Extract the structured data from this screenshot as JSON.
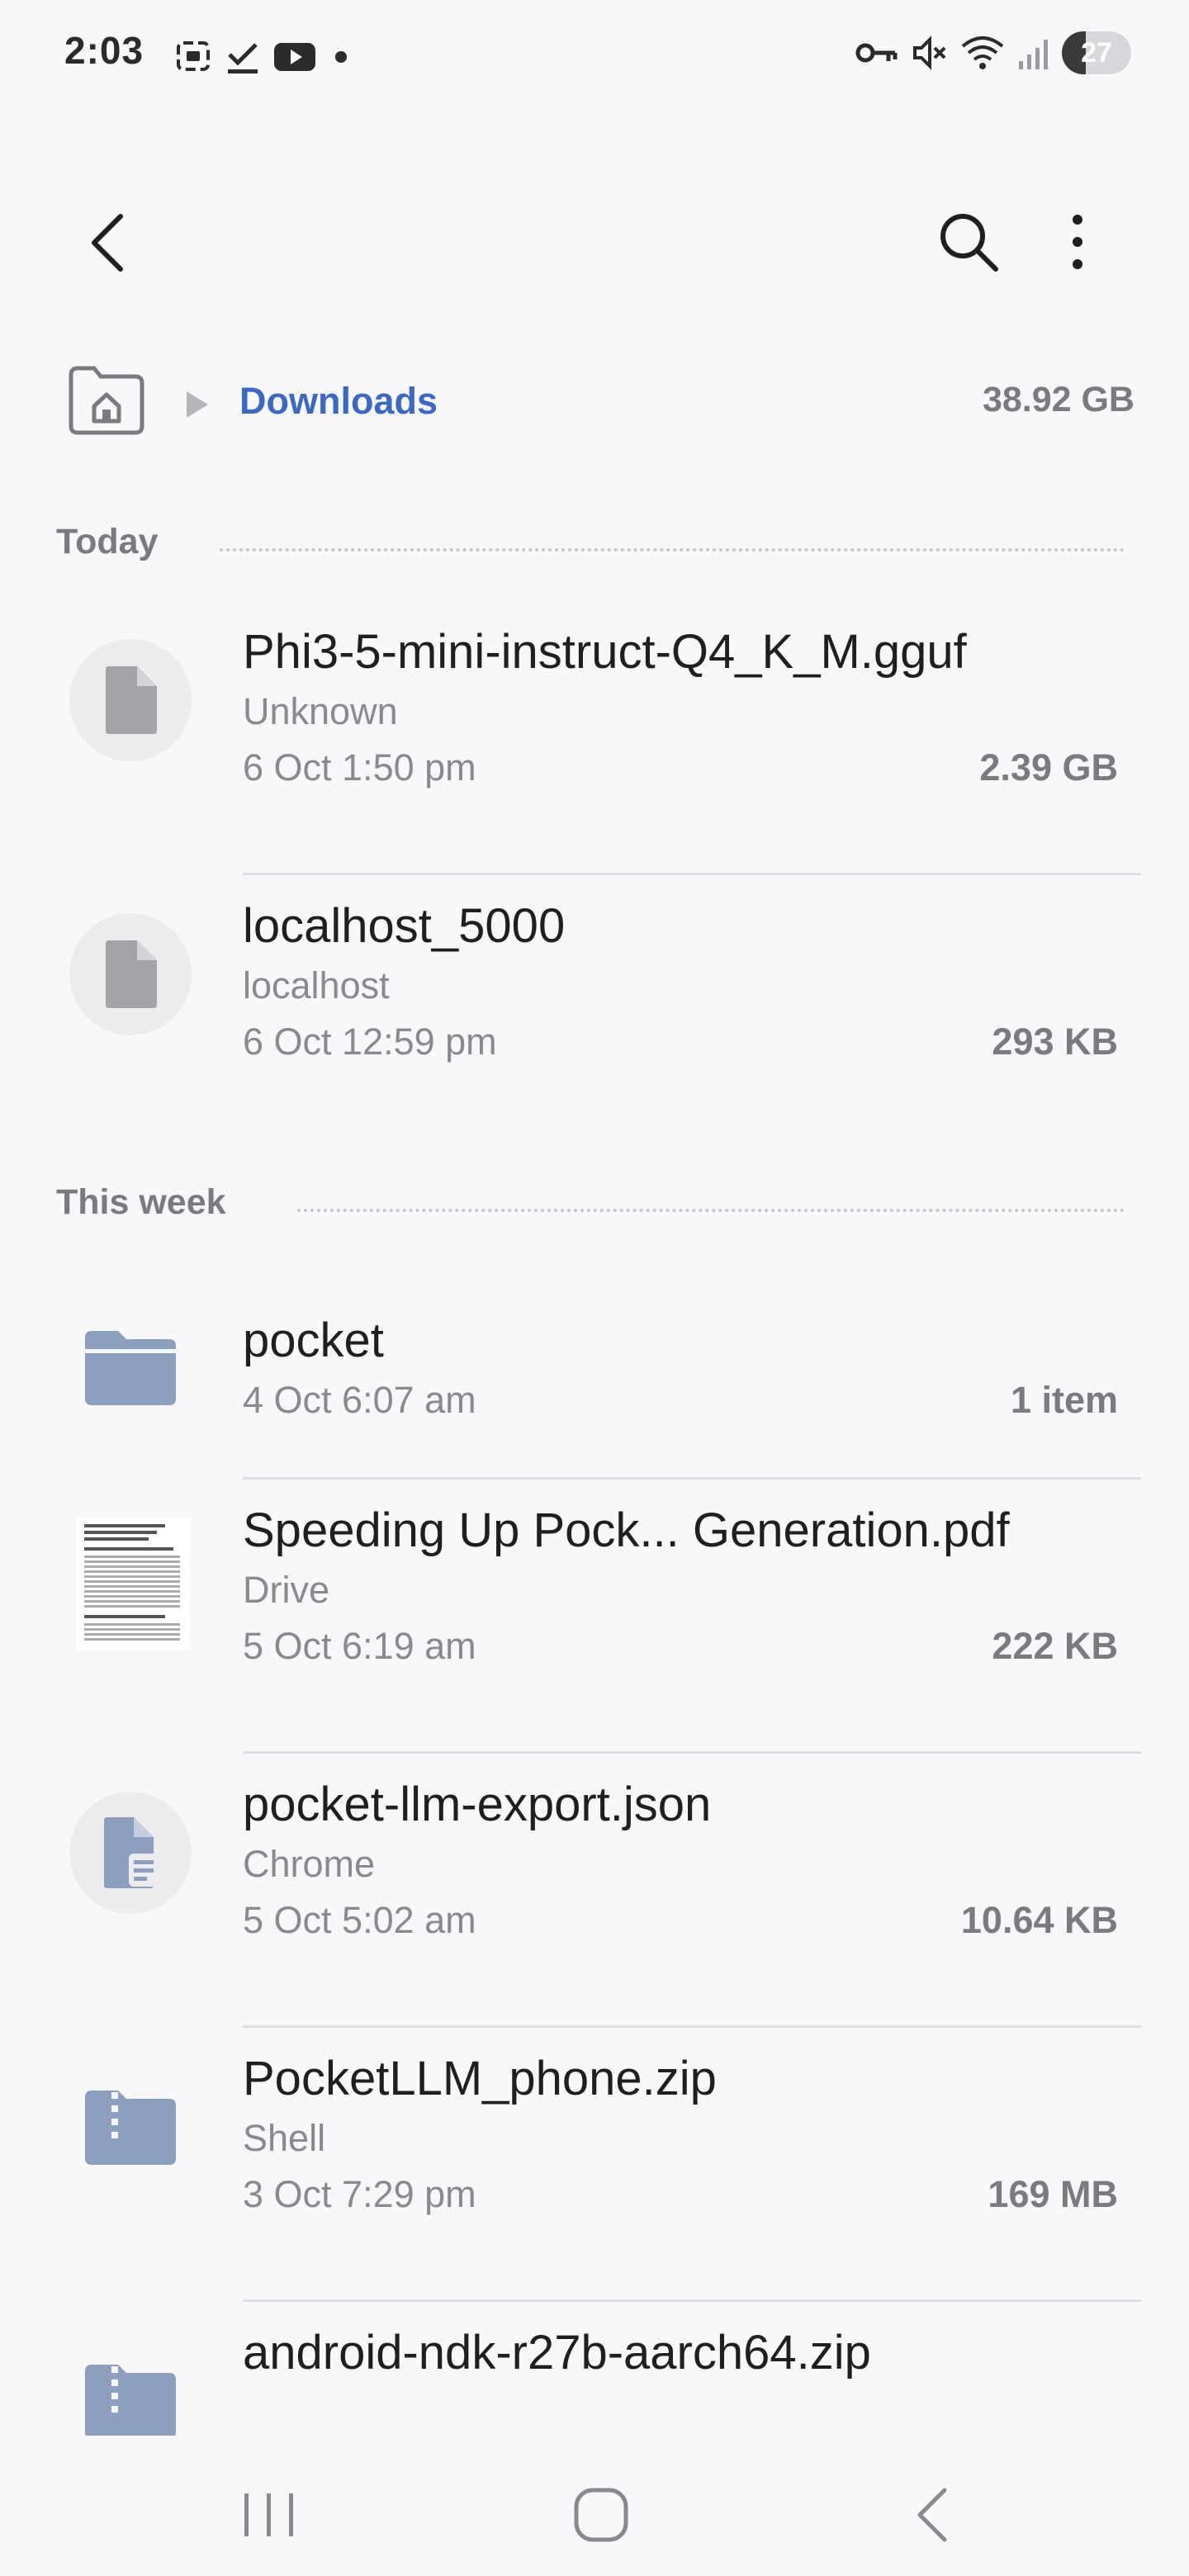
{
  "status_bar": {
    "time": "2:03",
    "battery": "27",
    "icons_left": [
      "screenshot-icon",
      "download-done-icon",
      "youtube-icon",
      "dot-icon"
    ],
    "icons_right": [
      "vpn-key-icon",
      "mute-icon",
      "wifi-icon",
      "signal-icon",
      "battery-icon"
    ]
  },
  "breadcrumb": {
    "current": "Downloads",
    "storage": "38.92 GB"
  },
  "sections": [
    {
      "label": "Today",
      "items": [
        {
          "name": "Phi3-5-mini-instruct-Q4_K_M.gguf",
          "source": "Unknown",
          "date": "6 Oct 1:50 pm",
          "size": "2.39 GB",
          "icon": "file-icon"
        },
        {
          "name": "localhost_5000",
          "source": "localhost",
          "date": "6 Oct 12:59 pm",
          "size": "293 KB",
          "icon": "file-icon"
        }
      ]
    },
    {
      "label": "This week",
      "items": [
        {
          "name": "pocket",
          "source": "",
          "date": "4 Oct 6:07 am",
          "size": "1 item",
          "icon": "folder-icon"
        },
        {
          "name": "Speeding Up Pock... Generation.pdf",
          "source": "Drive",
          "date": "5 Oct 6:19 am",
          "size": "222 KB",
          "icon": "pdf-thumbnail"
        },
        {
          "name": "pocket-llm-export.json",
          "source": "Chrome",
          "date": "5 Oct 5:02 am",
          "size": "10.64 KB",
          "icon": "document-icon"
        },
        {
          "name": "PocketLLM_phone.zip",
          "source": "Shell",
          "date": "3 Oct 7:29 pm",
          "size": "169 MB",
          "icon": "zip-folder-icon"
        },
        {
          "name": "android-ndk-r27b-aarch64.zip",
          "source": "",
          "date": "",
          "size": "",
          "icon": "zip-folder-icon"
        }
      ]
    }
  ],
  "colors": {
    "background": "#f8f8fb",
    "accent": "#3a68c7",
    "secondary_text": "#8a8a8e",
    "folder": "#8d9fc0"
  }
}
